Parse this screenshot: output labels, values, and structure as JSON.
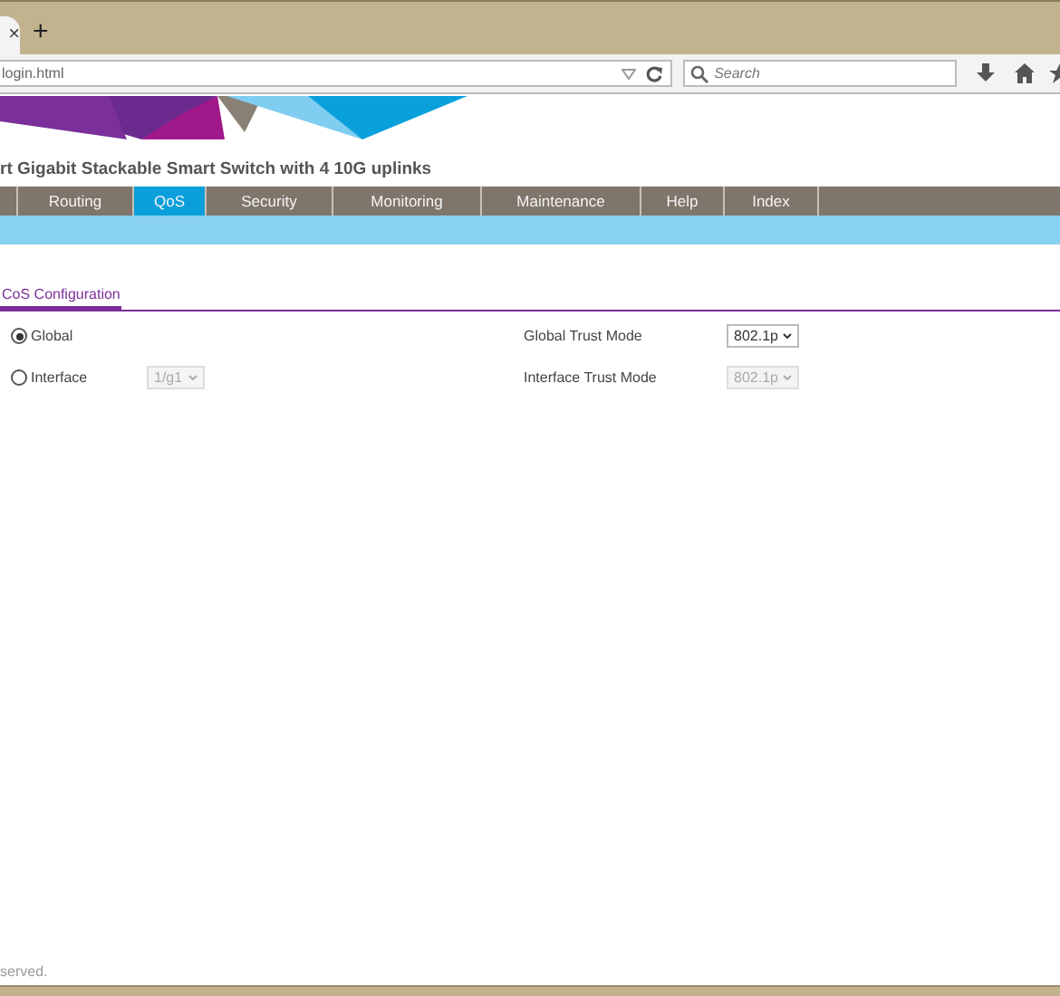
{
  "browser": {
    "tab_close": "×",
    "new_tab": "+",
    "url": "login.html",
    "search": {
      "placeholder": "Search"
    }
  },
  "header": {
    "title": "rt Gigabit Stackable Smart Switch with 4 10G uplinks"
  },
  "nav": [
    {
      "label": "Routing",
      "selected": false
    },
    {
      "label": "QoS",
      "selected": true
    },
    {
      "label": "Security",
      "selected": false
    },
    {
      "label": "Monitoring",
      "selected": false
    },
    {
      "label": "Maintenance",
      "selected": false
    },
    {
      "label": "Help",
      "selected": false
    },
    {
      "label": "Index",
      "selected": false
    }
  ],
  "subtabs": [
    {
      "label": "CoS Configuration",
      "selected": true
    }
  ],
  "options": [
    {
      "label": "Global",
      "selected": true,
      "mode_label": "Global Trust Mode",
      "mode": "802.1p",
      "disabled": false
    },
    {
      "label": "Interface",
      "selected": false,
      "port": "1/g1",
      "mode_label": "Interface Trust Mode",
      "mode": "802.1p",
      "disabled": true
    }
  ],
  "footer": "served."
}
